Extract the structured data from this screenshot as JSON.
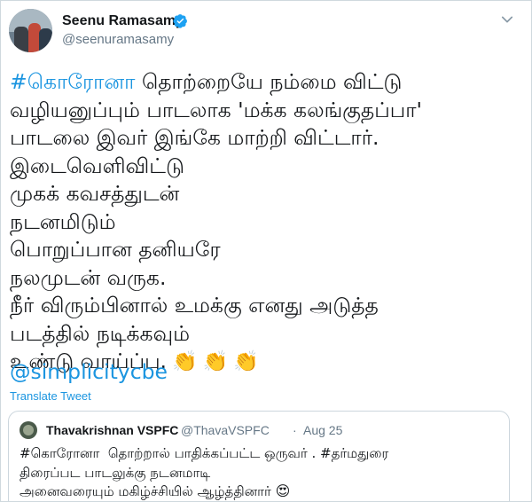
{
  "tweet": {
    "author_name": "Seenu Ramasamy",
    "author_handle": "@seenuramasamy",
    "hashtag": "#கொரோனா",
    "line1_rest": " தொற்றையே நம்மை விட்டு",
    "lines": [
      "வழியனுப்பும் பாடலாக 'மக்க கலங்குதப்பா'",
      "பாடலை இவர் இங்கே மாற்றி விட்டார்.",
      "இடைவெளிவிட்டு",
      "முகக் கவசத்துடன்",
      "நடனமிடும்",
      "பொறுப்பான தனியரே",
      "நலமுடன் வருக.",
      "நீர் விரும்பினால் உமக்கு எனது அடுத்த",
      "படத்தில் நடிக்கவும்"
    ],
    "last_line": "உண்டு வாய்ப்பு.",
    "claps": [
      "👏",
      "👏",
      "👏"
    ],
    "mention": "@simplicitycbe",
    "translate_label": "Translate Tweet"
  },
  "quote": {
    "author_name": "Thavakrishnan VSPFC",
    "author_handle": "@ThavaVSPFC",
    "separator": "·",
    "date": "Aug 25",
    "line1": "#கொரோனா  தொற்றால் பாதிக்கப்பட்ட ஒருவர் . #தர்மதுரை",
    "line2": "திரைப்பட பாடலுக்கு நடனமாடி",
    "line3": "அனைவரையும் மகிழ்ச்சியில் ஆழ்த்தினார்",
    "emoji": "😍"
  },
  "icons": {
    "verified": "verified-badge-icon",
    "more": "chevron-down-icon"
  },
  "colors": {
    "link": "#1b95e0",
    "text": "#14171a",
    "muted": "#657786",
    "verified": "#1da1f2"
  }
}
